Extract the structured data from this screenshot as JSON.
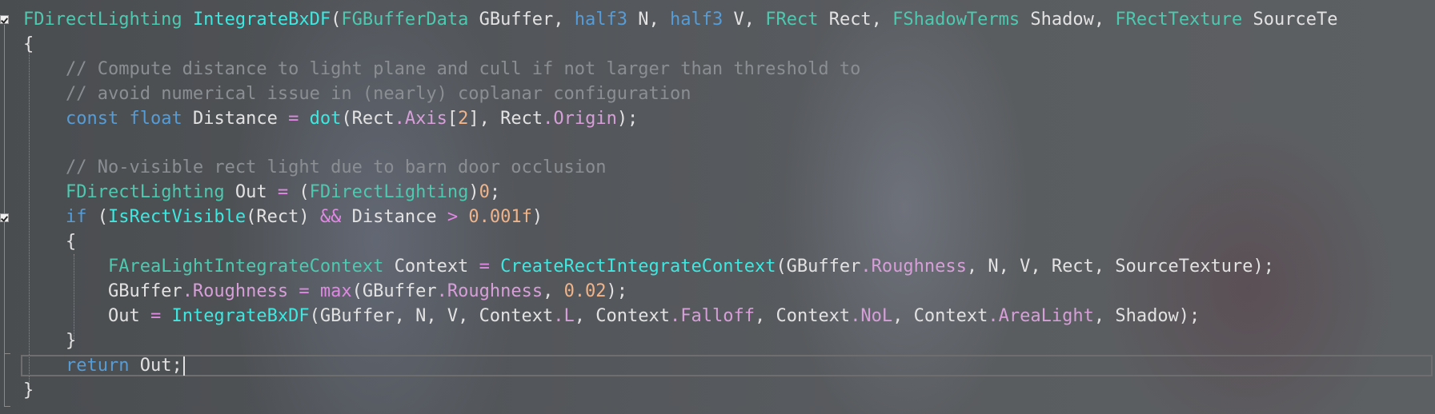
{
  "colors": {
    "type": "#4ec9b0",
    "function": "#3ee8e0",
    "keyword": "#569cd6",
    "comment": "#8b8f93",
    "member": "#d69fd8",
    "number": "#f0b48a",
    "text": "#e2e2e2"
  },
  "code": {
    "lines": [
      [
        {
          "t": "FDirectLighting",
          "c": "type"
        },
        {
          "t": " ",
          "c": "plain"
        },
        {
          "t": "IntegrateBxDF",
          "c": "func"
        },
        {
          "t": "(",
          "c": "plain"
        },
        {
          "t": "FGBufferData",
          "c": "type"
        },
        {
          "t": " GBuffer, ",
          "c": "plain"
        },
        {
          "t": "half3",
          "c": "kw"
        },
        {
          "t": " N, ",
          "c": "plain"
        },
        {
          "t": "half3",
          "c": "kw"
        },
        {
          "t": " V, ",
          "c": "plain"
        },
        {
          "t": "FRect",
          "c": "type"
        },
        {
          "t": " Rect, ",
          "c": "plain"
        },
        {
          "t": "FShadowTerms",
          "c": "type"
        },
        {
          "t": " Shadow, ",
          "c": "plain"
        },
        {
          "t": "FRectTexture",
          "c": "type"
        },
        {
          "t": " SourceTe",
          "c": "plain"
        }
      ],
      [
        {
          "t": "{",
          "c": "plain"
        }
      ],
      [
        {
          "t": "    ",
          "c": "plain"
        },
        {
          "t": "// Compute distance to light plane and cull if not larger than threshold to",
          "c": "comment"
        }
      ],
      [
        {
          "t": "    ",
          "c": "plain"
        },
        {
          "t": "// avoid numerical issue in (nearly) coplanar configuration",
          "c": "comment"
        }
      ],
      [
        {
          "t": "    ",
          "c": "plain"
        },
        {
          "t": "const",
          "c": "kw"
        },
        {
          "t": " ",
          "c": "plain"
        },
        {
          "t": "float",
          "c": "kw"
        },
        {
          "t": " Distance ",
          "c": "plain"
        },
        {
          "t": "=",
          "c": "op"
        },
        {
          "t": " ",
          "c": "plain"
        },
        {
          "t": "dot",
          "c": "func"
        },
        {
          "t": "(Rect",
          "c": "plain"
        },
        {
          "t": ".Axis",
          "c": "member"
        },
        {
          "t": "[",
          "c": "plain"
        },
        {
          "t": "2",
          "c": "num"
        },
        {
          "t": "], Rect",
          "c": "plain"
        },
        {
          "t": ".Origin",
          "c": "member"
        },
        {
          "t": ");",
          "c": "plain"
        }
      ],
      [],
      [
        {
          "t": "    ",
          "c": "plain"
        },
        {
          "t": "// No-visible rect light due to barn door occlusion",
          "c": "comment"
        }
      ],
      [
        {
          "t": "    ",
          "c": "plain"
        },
        {
          "t": "FDirectLighting",
          "c": "type"
        },
        {
          "t": " Out ",
          "c": "plain"
        },
        {
          "t": "=",
          "c": "op"
        },
        {
          "t": " (",
          "c": "plain"
        },
        {
          "t": "FDirectLighting",
          "c": "type"
        },
        {
          "t": ")",
          "c": "plain"
        },
        {
          "t": "0",
          "c": "num"
        },
        {
          "t": ";",
          "c": "plain"
        }
      ],
      [
        {
          "t": "    ",
          "c": "plain"
        },
        {
          "t": "if",
          "c": "kw"
        },
        {
          "t": " (",
          "c": "plain"
        },
        {
          "t": "IsRectVisible",
          "c": "func"
        },
        {
          "t": "(Rect) ",
          "c": "plain"
        },
        {
          "t": "&&",
          "c": "op"
        },
        {
          "t": " Distance ",
          "c": "plain"
        },
        {
          "t": ">",
          "c": "op"
        },
        {
          "t": " ",
          "c": "plain"
        },
        {
          "t": "0.001f",
          "c": "num"
        },
        {
          "t": ")",
          "c": "plain"
        }
      ],
      [
        {
          "t": "    {",
          "c": "plain"
        }
      ],
      [
        {
          "t": "        ",
          "c": "plain"
        },
        {
          "t": "FAreaLightIntegrateContext",
          "c": "type"
        },
        {
          "t": " Context ",
          "c": "plain"
        },
        {
          "t": "=",
          "c": "op"
        },
        {
          "t": " ",
          "c": "plain"
        },
        {
          "t": "CreateRectIntegrateContext",
          "c": "func"
        },
        {
          "t": "(GBuffer",
          "c": "plain"
        },
        {
          "t": ".Roughness",
          "c": "member"
        },
        {
          "t": ", N, V, Rect, SourceTexture);",
          "c": "plain"
        }
      ],
      [
        {
          "t": "        GBuffer",
          "c": "plain"
        },
        {
          "t": ".Roughness",
          "c": "member"
        },
        {
          "t": " ",
          "c": "plain"
        },
        {
          "t": "=",
          "c": "op"
        },
        {
          "t": " ",
          "c": "plain"
        },
        {
          "t": "max",
          "c": "op"
        },
        {
          "t": "(GBuffer",
          "c": "plain"
        },
        {
          "t": ".Roughness",
          "c": "member"
        },
        {
          "t": ", ",
          "c": "plain"
        },
        {
          "t": "0.02",
          "c": "num"
        },
        {
          "t": ");",
          "c": "plain"
        }
      ],
      [
        {
          "t": "        Out ",
          "c": "plain"
        },
        {
          "t": "=",
          "c": "op"
        },
        {
          "t": " ",
          "c": "plain"
        },
        {
          "t": "IntegrateBxDF",
          "c": "func"
        },
        {
          "t": "(GBuffer, N, V, Context",
          "c": "plain"
        },
        {
          "t": ".L",
          "c": "member"
        },
        {
          "t": ", Context",
          "c": "plain"
        },
        {
          "t": ".Falloff",
          "c": "member"
        },
        {
          "t": ", Context",
          "c": "plain"
        },
        {
          "t": ".NoL",
          "c": "member"
        },
        {
          "t": ", Context",
          "c": "plain"
        },
        {
          "t": ".AreaLight",
          "c": "member"
        },
        {
          "t": ", Shadow);",
          "c": "plain"
        }
      ],
      [
        {
          "t": "    }",
          "c": "plain"
        }
      ],
      [
        {
          "t": "    ",
          "c": "plain"
        },
        {
          "t": "return",
          "c": "kw"
        },
        {
          "t": " Out;",
          "c": "plain"
        }
      ],
      [
        {
          "t": "}",
          "c": "plain"
        }
      ]
    ]
  }
}
